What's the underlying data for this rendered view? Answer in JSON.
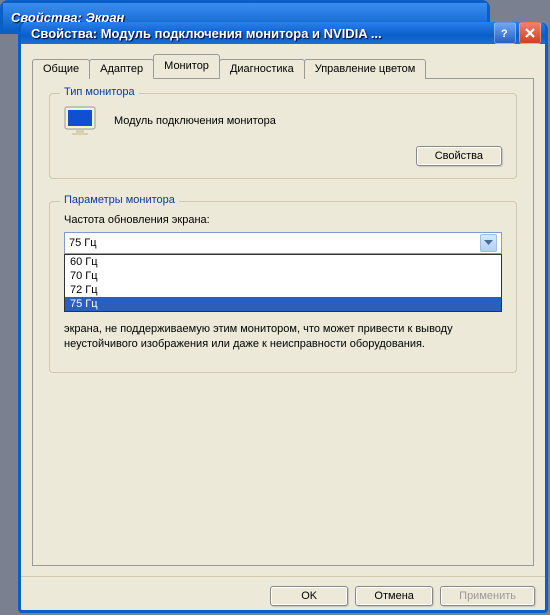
{
  "back_window": {
    "title": "Свойства: Экран"
  },
  "window": {
    "title": "Свойства: Модуль подключения монитора и NVIDIA ..."
  },
  "tabs": {
    "items": [
      {
        "label": "Общие"
      },
      {
        "label": "Адаптер"
      },
      {
        "label": "Монитор"
      },
      {
        "label": "Диагностика"
      },
      {
        "label": "Управление цветом"
      }
    ]
  },
  "monitor_type": {
    "legend": "Тип монитора",
    "name": "Модуль подключения монитора",
    "props_btn": "Свойства"
  },
  "params": {
    "legend": "Параметры монитора",
    "rate_label": "Частота обновления экрана:",
    "selected": "75 Гц",
    "options": [
      "60 Гц",
      "70 Гц",
      "72 Гц",
      "75 Гц"
    ],
    "hint_visible": "экрана, не поддерживаемую этим монитором, что может привести к выводу неустойчивого изображения или даже к неисправности оборудования."
  },
  "buttons": {
    "ok": "OK",
    "cancel": "Отмена",
    "apply": "Применить"
  }
}
